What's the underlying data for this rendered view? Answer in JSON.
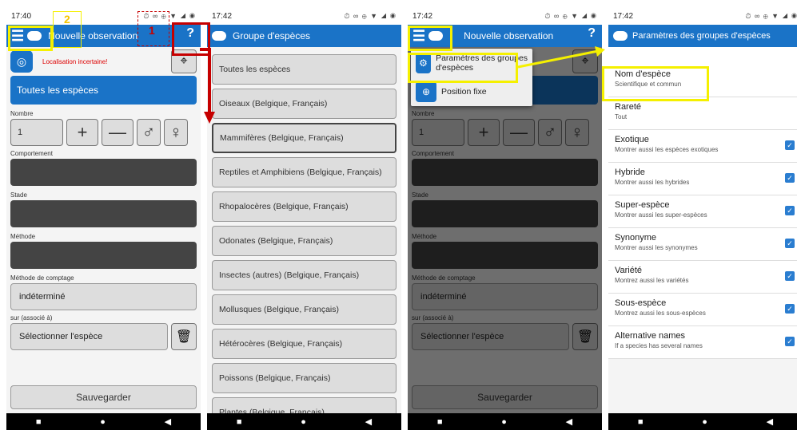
{
  "status_times": [
    "17:40",
    "17:42",
    "17:42",
    "17:42"
  ],
  "status_icons": "⏱ ∞ ⊕ ▼ ◢ ◉",
  "annotations": {
    "num1": "1",
    "num2": "2"
  },
  "panel1": {
    "app_title": "Nouvelle observation",
    "location_warning": "Localisation incertaine!",
    "species_button": "Toutes les espèces",
    "count_label": "Nombre",
    "count_value": "1",
    "plus": "+",
    "minus": "—",
    "male": "♂",
    "female": "♀",
    "behaviour_label": "Comportement",
    "stage_label": "Stade",
    "method_label": "Méthode",
    "count_method_label": "Méthode de comptage",
    "count_method_value": "indéterminé",
    "associated_label": "sur (associé à)",
    "associated_placeholder": "Sélectionner l'espèce",
    "save": "Sauvegarder"
  },
  "panel2": {
    "title": "Groupe d'espèces",
    "groups": [
      "Toutes les espèces",
      "Oiseaux (Belgique, Français)",
      "Mammifères (Belgique, Français)",
      "Reptiles et Amphibiens (Belgique, Français)",
      "Rhopalocères (Belgique, Français)",
      "Odonates (Belgique, Français)",
      "Insectes (autres) (Belgique, Français)",
      "Mollusques (Belgique, Français)",
      "Hétérocères (Belgique, Français)",
      "Poissons (Belgique, Français)",
      "Plantes (Belgique, Français)"
    ]
  },
  "panel3": {
    "menu": [
      "Paramètres des groupes d'espèces",
      "Position fixe"
    ]
  },
  "panel4": {
    "title": "Paramètres des groupes d'espèces",
    "settings": [
      {
        "title": "Nom d'espèce",
        "sub": "Scientifique et commun",
        "check": false
      },
      {
        "title": "Rareté",
        "sub": "Tout",
        "check": false
      },
      {
        "title": "Exotique",
        "sub": "Montrer aussi les espèces exotiques",
        "check": true
      },
      {
        "title": "Hybride",
        "sub": "Montrer aussi les hybrides",
        "check": true
      },
      {
        "title": "Super-espèce",
        "sub": "Montrer aussi les super-espèces",
        "check": true
      },
      {
        "title": "Synonyme",
        "sub": "Montrer aussi les synonymes",
        "check": true
      },
      {
        "title": "Variété",
        "sub": "Montrez aussi les variétés",
        "check": true
      },
      {
        "title": "Sous-espèce",
        "sub": "Montrez aussi les sous-espèces",
        "check": true
      },
      {
        "title": "Alternative names",
        "sub": "If a species has several names",
        "check": true
      }
    ]
  },
  "nav": {
    "square": "■",
    "circle": "●",
    "back": "◀"
  },
  "colors": {
    "accent": "#1a73c7",
    "highlight_yellow": "#f5f000",
    "highlight_red": "#c60000"
  }
}
